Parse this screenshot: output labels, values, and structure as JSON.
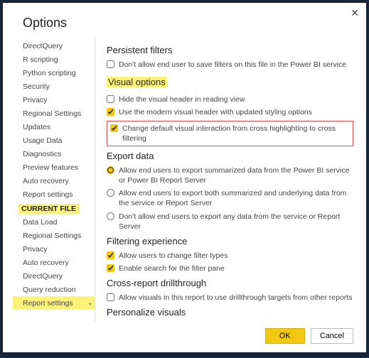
{
  "dialog": {
    "title": "Options",
    "close_glyph": "✕"
  },
  "sidebar": {
    "global_items": [
      "DirectQuery",
      "R scripting",
      "Python scripting",
      "Security",
      "Privacy",
      "Regional Settings",
      "Updates",
      "Usage Data",
      "Diagnostics",
      "Preview features",
      "Auto recovery",
      "Report settings"
    ],
    "current_file_header": "CURRENT FILE",
    "current_file_items": [
      "Data Load",
      "Regional Settings",
      "Privacy",
      "Auto recovery",
      "DirectQuery",
      "Query reduction",
      "Report settings"
    ]
  },
  "sections": {
    "persistent": {
      "title": "Persistent filters",
      "opt1": "Don't allow end user to save filters on this file in the Power BI service"
    },
    "visual": {
      "title": "Visual options",
      "opt1": "Hide the visual header in reading view",
      "opt2": "Use the modern visual header with updated styling options",
      "opt3": "Change default visual interaction from cross highlighting to cross filtering"
    },
    "export": {
      "title": "Export data",
      "opt1": "Allow end users to export summarized data from the Power BI service or Power BI Report Server",
      "opt2": "Allow end users to export both summarized and underlying data from the service or Report Server",
      "opt3": "Don't allow end users to export any data from the service or Report Server"
    },
    "filtering": {
      "title": "Filtering experience",
      "opt1": "Allow users to change filter types",
      "opt2": "Enable search for the filter pane"
    },
    "drill": {
      "title": "Cross-report drillthrough",
      "opt1": "Allow visuals in this report to use drillthrough targets from other reports"
    },
    "personalize": {
      "title": "Personalize visuals"
    }
  },
  "footer": {
    "ok": "OK",
    "cancel": "Cancel"
  },
  "colors": {
    "accent": "#f2c811",
    "highlight": "#fff27a",
    "callout": "#d9534f"
  }
}
